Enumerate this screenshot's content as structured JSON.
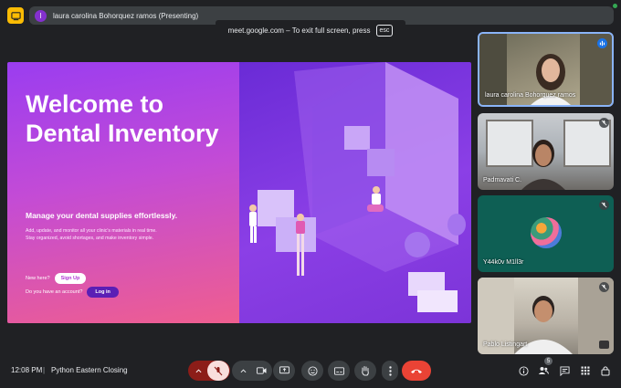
{
  "presenting": {
    "initial": "l",
    "label": "laura carolina Bohorquez ramos (Presenting)"
  },
  "banner": {
    "text": "meet.google.com – To exit full screen, press",
    "key": "esc"
  },
  "slide": {
    "title": "Welcome to Dental Inventory",
    "tagline": "Manage your dental supplies effortlessly.",
    "body": "Add, update, and monitor all your clinic's materials in real time. Stay organized, avoid shortages, and make inventory simple.",
    "new_here": "New here?",
    "signup": "Sign Up",
    "have_account": "Do you have an account?",
    "login": "Log in",
    "colors": {
      "left_top": "#9a3df0",
      "left_bottom": "#ef5e8f",
      "right": "#7c34d8"
    }
  },
  "participants": [
    {
      "name": "laura carolina Bohorquez ramos",
      "state": "speaking"
    },
    {
      "name": "Padmavati C.",
      "state": "muted"
    },
    {
      "name": "Y44k0v M1ll3r",
      "state": "muted"
    },
    {
      "name": "Pablo Listingart",
      "state": "muted"
    }
  ],
  "bottom": {
    "time": "12:08 PM",
    "separator": "|",
    "meeting": "Python Eastern Closing",
    "people_count": "5"
  },
  "icons": [
    "present-icon",
    "mic-off-icon",
    "camera-icon",
    "present-screen-icon",
    "emoji-icon",
    "captions-icon",
    "raise-hand-icon",
    "more-icon",
    "end-call-icon",
    "info-icon",
    "people-icon",
    "chat-icon",
    "activities-icon",
    "host-controls-icon"
  ]
}
